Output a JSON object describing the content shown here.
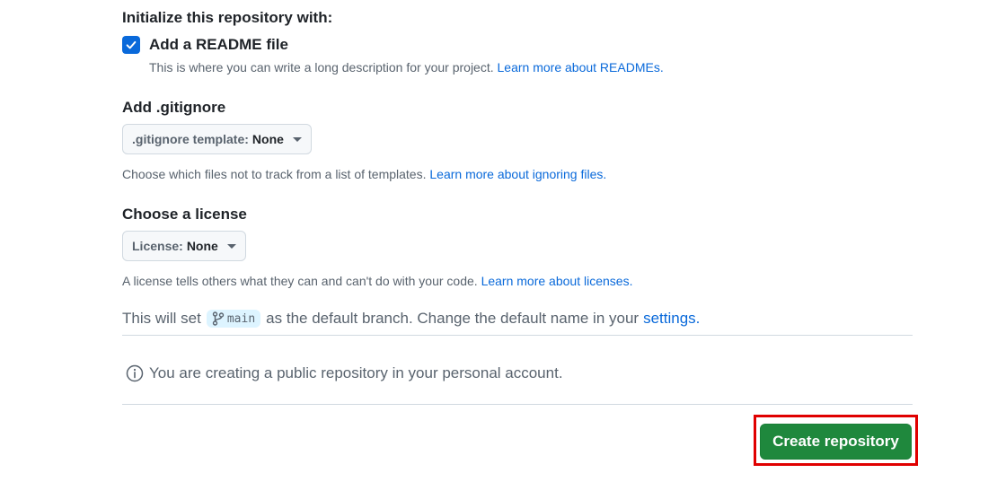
{
  "init": {
    "heading": "Initialize this repository with:",
    "readme_label": "Add a README file",
    "readme_checked": true,
    "readme_desc": "This is where you can write a long description for your project.",
    "readme_link": "Learn more about READMEs."
  },
  "gitignore": {
    "heading": "Add .gitignore",
    "dropdown_key": ".gitignore template:",
    "dropdown_value": "None",
    "hint": "Choose which files not to track from a list of templates.",
    "hint_link": "Learn more about ignoring files."
  },
  "license": {
    "heading": "Choose a license",
    "dropdown_key": "License:",
    "dropdown_value": "None",
    "hint": "A license tells others what they can and can't do with your code.",
    "hint_link": "Learn more about licenses."
  },
  "branch": {
    "prefix": "This will set",
    "name": "main",
    "middle": "as the default branch. Change the default name in your",
    "link": "settings."
  },
  "info": {
    "text": "You are creating a public repository in your personal account."
  },
  "actions": {
    "create_label": "Create repository"
  },
  "colors": {
    "accent": "#0969da",
    "primary_button": "#1f883d",
    "highlight": "#e00000"
  }
}
